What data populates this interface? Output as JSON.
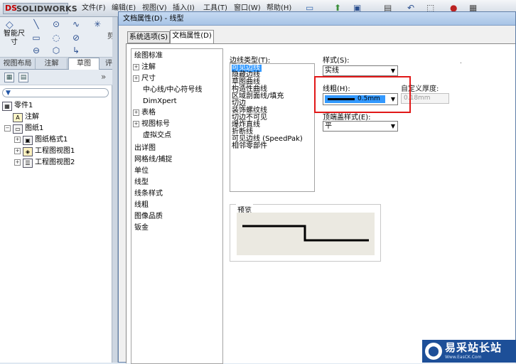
{
  "app": {
    "logo_text": "SOLIDWORKS",
    "logo_mark": "DS"
  },
  "menu": [
    "文件(F)",
    "编辑(E)",
    "视图(V)",
    "插入(I)",
    "工具(T)",
    "窗口(W)",
    "帮助(H)"
  ],
  "command_manager": {
    "smart_dimension": "智能尺寸",
    "cut_label": "剪"
  },
  "view_tabs": [
    "视图布局",
    "注解",
    "草图",
    "评"
  ],
  "feature_tree": {
    "items": [
      {
        "label": "零件1",
        "level": 0
      },
      {
        "label": "注解",
        "level": 1
      },
      {
        "label": "图纸1",
        "level": 1
      },
      {
        "label": "图纸格式1",
        "level": 2
      },
      {
        "label": "工程图视图1",
        "level": 2
      },
      {
        "label": "工程图视图2",
        "level": 2
      }
    ]
  },
  "dialog": {
    "title": "文档属性(D) - 线型",
    "tabs": [
      "系统选项(S)",
      "文档属性(D)"
    ],
    "nav": [
      "绘图标准",
      "注解",
      "尺寸",
      "中心线/中心符号线",
      "DimXpert",
      "表格",
      "视图标号",
      "虚拟交点",
      "出详图",
      "网格线/捕捉",
      "单位",
      "线型",
      "线条样式",
      "线粗",
      "图像品质",
      "钣金"
    ],
    "edge_type_label": "边线类型(T):",
    "edge_types": [
      "可见边线",
      "隐藏边线",
      "草图曲线",
      "构造性曲线",
      "区域剖面线/填充",
      "切边",
      "装饰螺纹线",
      "切边不可见",
      "爆炸直线",
      "折断线",
      "可见边线 (SpeedPak)",
      "相邻零部件"
    ],
    "style_label": "样式(S):",
    "style_value": "实线",
    "thickness_label": "线粗(H):",
    "thickness_value": "0.5mm",
    "custom_label": "自定义厚度:",
    "custom_value": "0.18mm",
    "end_cap_label": "顶端盖样式(E):",
    "end_cap_value": "平",
    "preview_label": "预览",
    "dot": "."
  },
  "watermark": {
    "text": "易采站长站",
    "url": "Www.EasCK.Com"
  },
  "colors": {
    "selection": "#3399ff",
    "highlight_box": "#e11818",
    "watermark_bg": "#1d4f98"
  }
}
